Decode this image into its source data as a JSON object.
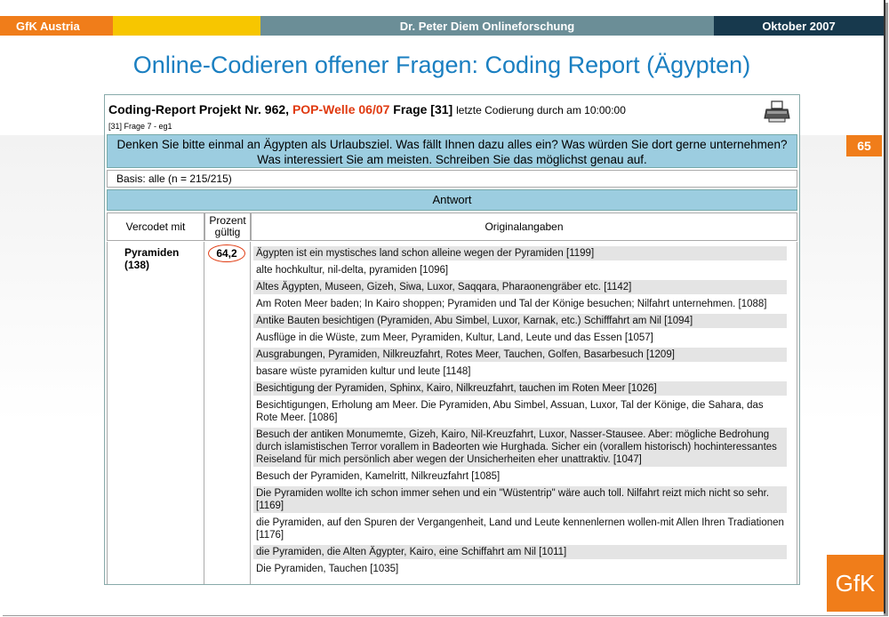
{
  "topbar": {
    "company": "GfK Austria",
    "author": "Dr. Peter Diem  Onlineforschung",
    "date": "Oktober 2007"
  },
  "slide_title": "Online-Codieren offener Fragen: Coding Report (Ägypten)",
  "page_number": "65",
  "logo_text": "GfK",
  "report": {
    "title_prefix": "Coding-Report Projekt Nr. 962, ",
    "title_wave": "POP-Welle 06/07",
    "title_question": " Frage [31] ",
    "title_suffix": "letzte Codierung durch am 10:00:00",
    "subtitle": "[31] Frage 7 - eg1",
    "question": "Denken Sie bitte einmal an Ägypten als Urlaubsziel. Was fällt Ihnen dazu alles ein? Was würden Sie dort gerne unternehmen? Was interessiert Sie am meisten. Schreiben Sie das möglichst genau auf.",
    "basis": "Basis: alle (n = 215/215)",
    "antwort": "Antwort",
    "col_code": "Vercodet mit",
    "col_pct_1": "Prozent",
    "col_pct_2": "gültig",
    "col_orig": "Originalangaben",
    "code_name": "Pyramiden",
    "code_count": "(138)",
    "percent": "64,2",
    "answers": [
      "Ägypten ist ein mystisches land schon alleine wegen der Pyramiden [1199]",
      "alte hochkultur, nil-delta, pyramiden [1096]",
      "Altes Ägypten, Museen, Gizeh, Siwa, Luxor, Saqqara, Pharaonengräber etc. [1142]",
      "Am Roten Meer baden; In Kairo shoppen; Pyramiden und Tal der Könige besuchen; Nilfahrt unternehmen. [1088]",
      "Antike Bauten besichtigen (Pyramiden, Abu Simbel, Luxor, Karnak, etc.) Schifffahrt am Nil [1094]",
      "Ausflüge in die Wüste, zum Meer, Pyramiden, Kultur, Land, Leute und das Essen [1057]",
      "Ausgrabungen, Pyramiden, Nilkreuzfahrt, Rotes Meer, Tauchen, Golfen, Basarbesuch [1209]",
      "basare wüste pyramiden kultur und leute [1148]",
      "Besichtigung der Pyramiden, Sphinx, Kairo, Nilkreuzfahrt, tauchen im Roten Meer [1026]",
      "Besichtigungen, Erholung am Meer. Die Pyramiden, Abu Simbel, Assuan, Luxor, Tal der Könige, die Sahara, das Rote Meer. [1086]",
      "Besuch der antiken Monumemte, Gizeh, Kairo, Nil-Kreuzfahrt, Luxor, Nasser-Stausee. Aber: mögliche Bedrohung durch islamistischen Terror vorallem in Badeorten wie Hurghada. Sicher ein (vorallem historisch) hochinteressantes Reiseland für mich persönlich aber wegen der Unsicherheiten eher unattraktiv. [1047]",
      "Besuch der Pyramiden, Kamelritt, Nilkreuzfahrt [1085]",
      "Die Pyramiden wollte ich schon immer sehen und ein \"Wüstentrip\" wäre auch toll. Nilfahrt reizt mich nicht so sehr. [1169]",
      "die Pyramiden, auf den Spuren der Vergangenheit, Land und Leute kennenlernen wollen-mit Allen Ihren Tradiationen [1176]",
      "die Pyramiden, die Alten Ägypter, Kairo, eine Schiffahrt am Nil [1011]",
      "Die Pyramiden, Tauchen [1035]"
    ]
  }
}
